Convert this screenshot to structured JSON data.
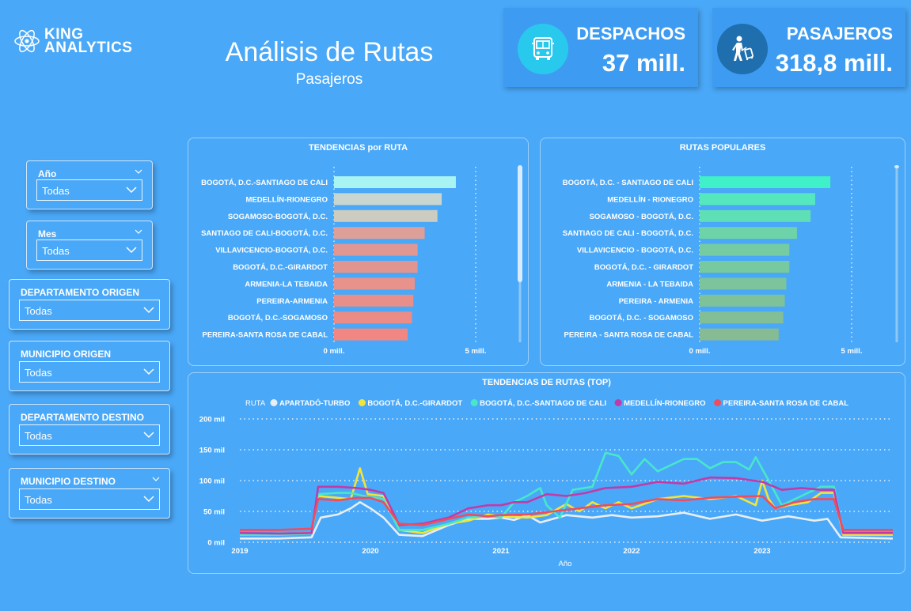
{
  "logo": {
    "line1": "KING",
    "line2": "ANALYTICS"
  },
  "header": {
    "title": "Análisis de Rutas",
    "subtitle": "Pasajeros"
  },
  "kpis": [
    {
      "label": "DESPACHOS",
      "value": "37 mill.",
      "icon": "bus-icon",
      "icon_bg": "#29c9ee"
    },
    {
      "label": "PASAJEROS",
      "value": "318,8 mill.",
      "icon": "traveler-icon",
      "icon_bg": "#1f6fae"
    }
  ],
  "slicers": [
    {
      "title": "Año",
      "value": "Todas"
    },
    {
      "title": "Mes",
      "value": "Todas"
    },
    {
      "title": "DEPARTAMENTO ORIGEN",
      "value": "Todas"
    },
    {
      "title": "MUNICIPIO ORIGEN",
      "value": "Todas"
    },
    {
      "title": "DEPARTAMENTO DESTINO",
      "value": "Todas"
    },
    {
      "title": "MUNICIPIO DESTINO",
      "value": "Todas"
    }
  ],
  "chart_data": [
    {
      "type": "bar",
      "title": "TENDENCIAS  por RUTA",
      "orientation": "horizontal",
      "categories": [
        "BOGOTÁ, D.C.-SANTIAGO DE CALI",
        "MEDELLÍN-RIONEGRO",
        "SOGAMOSO-BOGOTÁ, D.C.",
        "SANTIAGO DE CALI-BOGOTÁ, D.C.",
        "VILLAVICENCIO-BOGOTÁ, D.C.",
        "BOGOTÁ, D.C.-GIRARDOT",
        "ARMENIA-LA TEBAIDA",
        "PEREIRA-ARMENIA",
        "BOGOTÁ, D.C.-SOGAMOSO",
        "PEREIRA-SANTA ROSA DE CABAL"
      ],
      "values": [
        4.3,
        3.8,
        3.65,
        3.2,
        2.95,
        2.95,
        2.85,
        2.8,
        2.75,
        2.6
      ],
      "colors": [
        "#a8f4f2",
        "#c8d6cf",
        "#cdccc1",
        "#de9f98",
        "#e29892",
        "#e0958f",
        "#e8928c",
        "#e98f89",
        "#eb8c86",
        "#f08782"
      ],
      "xticks": [
        "0 mill.",
        "5 mill."
      ],
      "xlim": [
        0,
        5
      ]
    },
    {
      "type": "bar",
      "title": "RUTAS POPULARES",
      "orientation": "horizontal",
      "categories": [
        "BOGOTÁ, D.C. - SANTIAGO DE CALI",
        "MEDELLÍN - RIONEGRO",
        "SOGAMOSO - BOGOTÁ, D.C.",
        "SANTIAGO DE CALI - BOGOTÁ, D.C.",
        "VILLAVICENCIO - BOGOTÁ, D.C.",
        "BOGOTÁ, D.C. - GIRARDOT",
        "ARMENIA - LA TEBAIDA",
        "PEREIRA - ARMENIA",
        "BOGOTÁ, D.C. - SOGAMOSO",
        "PEREIRA - SANTA ROSA DE CABAL"
      ],
      "values": [
        4.3,
        3.8,
        3.65,
        3.2,
        2.95,
        2.95,
        2.85,
        2.8,
        2.75,
        2.6
      ],
      "colors": [
        "#3ff0c8",
        "#55e8bf",
        "#5fdfb5",
        "#6ed3a8",
        "#76cca2",
        "#77c99f",
        "#7cc49b",
        "#7fc299",
        "#82bf96",
        "#86bb93"
      ],
      "xticks": [
        "0 mill.",
        "5 mill."
      ],
      "xlim": [
        0,
        5
      ]
    },
    {
      "type": "line",
      "title": "TENDENCIAS DE RUTAS (TOP)",
      "legend_title": "RUTA",
      "xlabel": "Año",
      "xticks": [
        "2019",
        "2020",
        "2021",
        "2022",
        "2023"
      ],
      "yticks": [
        "0 mil",
        "50 mil",
        "100 mil",
        "150 mil",
        "200 mil"
      ],
      "ylim": [
        0,
        200
      ],
      "xlim": [
        2019.0,
        2024.0
      ],
      "series": [
        {
          "name": "APARTADÓ-TURBO",
          "color": "#e8eef4",
          "points": [
            [
              2019.0,
              6
            ],
            [
              2019.3,
              6
            ],
            [
              2019.55,
              8
            ],
            [
              2019.62,
              40
            ],
            [
              2019.75,
              45
            ],
            [
              2019.85,
              55
            ],
            [
              2019.92,
              65
            ],
            [
              2020.0,
              55
            ],
            [
              2020.1,
              40
            ],
            [
              2020.22,
              12
            ],
            [
              2020.4,
              10
            ],
            [
              2020.6,
              28
            ],
            [
              2020.75,
              38
            ],
            [
              2020.9,
              38
            ],
            [
              2021.0,
              40
            ],
            [
              2021.1,
              36
            ],
            [
              2021.2,
              44
            ],
            [
              2021.3,
              32
            ],
            [
              2021.5,
              44
            ],
            [
              2021.7,
              40
            ],
            [
              2021.85,
              44
            ],
            [
              2022.0,
              40
            ],
            [
              2022.2,
              42
            ],
            [
              2022.4,
              48
            ],
            [
              2022.6,
              38
            ],
            [
              2022.8,
              45
            ],
            [
              2023.0,
              35
            ],
            [
              2023.2,
              42
            ],
            [
              2023.4,
              35
            ],
            [
              2023.5,
              38
            ],
            [
              2023.6,
              8
            ],
            [
              2024.0,
              6
            ]
          ]
        },
        {
          "name": "BOGOTÁ, D.C.-GIRARDOT",
          "color": "#f2e43b",
          "points": [
            [
              2019.0,
              12
            ],
            [
              2019.3,
              14
            ],
            [
              2019.55,
              15
            ],
            [
              2019.6,
              75
            ],
            [
              2019.75,
              72
            ],
            [
              2019.85,
              70
            ],
            [
              2019.92,
              120
            ],
            [
              2019.98,
              78
            ],
            [
              2020.1,
              75
            ],
            [
              2020.22,
              20
            ],
            [
              2020.4,
              15
            ],
            [
              2020.6,
              30
            ],
            [
              2020.75,
              35
            ],
            [
              2020.9,
              45
            ],
            [
              2021.0,
              42
            ],
            [
              2021.2,
              40
            ],
            [
              2021.35,
              44
            ],
            [
              2021.5,
              62
            ],
            [
              2021.6,
              50
            ],
            [
              2021.7,
              65
            ],
            [
              2021.8,
              55
            ],
            [
              2021.9,
              65
            ],
            [
              2022.0,
              55
            ],
            [
              2022.2,
              70
            ],
            [
              2022.4,
              75
            ],
            [
              2022.6,
              70
            ],
            [
              2022.8,
              75
            ],
            [
              2022.95,
              60
            ],
            [
              2023.0,
              100
            ],
            [
              2023.05,
              70
            ],
            [
              2023.1,
              55
            ],
            [
              2023.2,
              60
            ],
            [
              2023.35,
              65
            ],
            [
              2023.45,
              80
            ],
            [
              2023.55,
              80
            ],
            [
              2023.62,
              12
            ],
            [
              2024.0,
              12
            ]
          ]
        },
        {
          "name": "BOGOTÁ, D.C.-SANTIAGO DE CALI",
          "color": "#48e7c9",
          "points": [
            [
              2019.0,
              12
            ],
            [
              2019.3,
              12
            ],
            [
              2019.55,
              14
            ],
            [
              2019.6,
              78
            ],
            [
              2019.75,
              80
            ],
            [
              2019.85,
              80
            ],
            [
              2019.95,
              75
            ],
            [
              2020.1,
              70
            ],
            [
              2020.22,
              20
            ],
            [
              2020.4,
              20
            ],
            [
              2020.6,
              30
            ],
            [
              2020.75,
              40
            ],
            [
              2020.9,
              42
            ],
            [
              2021.0,
              40
            ],
            [
              2021.1,
              65
            ],
            [
              2021.2,
              75
            ],
            [
              2021.3,
              88
            ],
            [
              2021.35,
              60
            ],
            [
              2021.45,
              40
            ],
            [
              2021.55,
              85
            ],
            [
              2021.7,
              90
            ],
            [
              2021.8,
              145
            ],
            [
              2021.9,
              140
            ],
            [
              2022.0,
              110
            ],
            [
              2022.1,
              135
            ],
            [
              2022.2,
              115
            ],
            [
              2022.3,
              125
            ],
            [
              2022.4,
              135
            ],
            [
              2022.5,
              135
            ],
            [
              2022.6,
              120
            ],
            [
              2022.7,
              130
            ],
            [
              2022.8,
              130
            ],
            [
              2022.9,
              118
            ],
            [
              2022.95,
              138
            ],
            [
              2023.05,
              100
            ],
            [
              2023.15,
              60
            ],
            [
              2023.3,
              75
            ],
            [
              2023.45,
              90
            ],
            [
              2023.55,
              90
            ],
            [
              2023.62,
              15
            ],
            [
              2024.0,
              15
            ]
          ]
        },
        {
          "name": "MEDELLÍN-RIONEGRO",
          "color": "#c23aa8",
          "points": [
            [
              2019.0,
              15
            ],
            [
              2019.3,
              14
            ],
            [
              2019.55,
              15
            ],
            [
              2019.6,
              90
            ],
            [
              2019.75,
              90
            ],
            [
              2019.9,
              88
            ],
            [
              2020.0,
              85
            ],
            [
              2020.1,
              80
            ],
            [
              2020.22,
              28
            ],
            [
              2020.4,
              30
            ],
            [
              2020.6,
              40
            ],
            [
              2020.75,
              55
            ],
            [
              2020.9,
              60
            ],
            [
              2021.0,
              60
            ],
            [
              2021.1,
              65
            ],
            [
              2021.2,
              65
            ],
            [
              2021.35,
              78
            ],
            [
              2021.5,
              75
            ],
            [
              2021.65,
              80
            ],
            [
              2021.8,
              88
            ],
            [
              2022.0,
              90
            ],
            [
              2022.2,
              98
            ],
            [
              2022.4,
              95
            ],
            [
              2022.6,
              105
            ],
            [
              2022.8,
              104
            ],
            [
              2023.0,
              98
            ],
            [
              2023.15,
              85
            ],
            [
              2023.3,
              88
            ],
            [
              2023.45,
              85
            ],
            [
              2023.55,
              85
            ],
            [
              2023.62,
              15
            ],
            [
              2024.0,
              15
            ]
          ]
        },
        {
          "name": "PEREIRA-SANTA ROSA DE CABAL",
          "color": "#ef4c5f",
          "points": [
            [
              2019.0,
              20
            ],
            [
              2019.3,
              20
            ],
            [
              2019.55,
              22
            ],
            [
              2019.6,
              70
            ],
            [
              2019.75,
              68
            ],
            [
              2019.9,
              72
            ],
            [
              2020.0,
              72
            ],
            [
              2020.1,
              65
            ],
            [
              2020.22,
              30
            ],
            [
              2020.4,
              28
            ],
            [
              2020.6,
              38
            ],
            [
              2020.75,
              45
            ],
            [
              2020.9,
              42
            ],
            [
              2021.0,
              44
            ],
            [
              2021.2,
              45
            ],
            [
              2021.4,
              50
            ],
            [
              2021.6,
              55
            ],
            [
              2021.8,
              60
            ],
            [
              2022.0,
              62
            ],
            [
              2022.2,
              70
            ],
            [
              2022.4,
              68
            ],
            [
              2022.6,
              72
            ],
            [
              2022.8,
              74
            ],
            [
              2023.0,
              75
            ],
            [
              2023.1,
              55
            ],
            [
              2023.25,
              65
            ],
            [
              2023.4,
              70
            ],
            [
              2023.55,
              70
            ],
            [
              2023.62,
              20
            ],
            [
              2024.0,
              20
            ]
          ]
        }
      ]
    }
  ]
}
